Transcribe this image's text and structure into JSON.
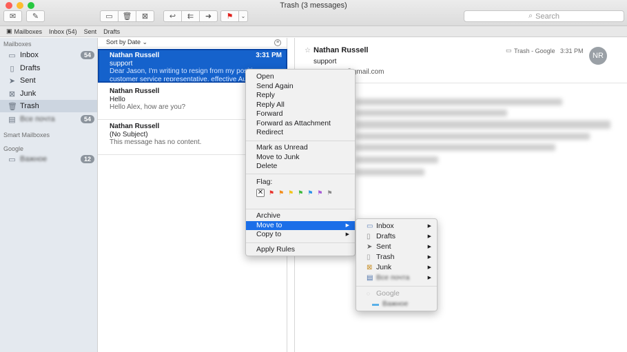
{
  "window": {
    "title": "Trash (3 messages)"
  },
  "colors": {
    "selection": "#1562cc",
    "menu_highlight": "#1b6ee8",
    "sidebar": "#e4e9ef"
  },
  "toolbar": {
    "buttons": [
      "mail-icon",
      "compose-icon",
      "archive-icon",
      "trash-icon",
      "junk-icon",
      "reply-icon",
      "reply-all-icon",
      "forward-icon",
      "flag-icon",
      "chevron-down-icon"
    ],
    "search_placeholder": "Search"
  },
  "favorites": {
    "mailboxes": "Mailboxes",
    "inbox": "Inbox (54)",
    "sent": "Sent",
    "drafts": "Drafts"
  },
  "sidebar": {
    "section_mailboxes": "Mailboxes",
    "items": [
      {
        "label": "Inbox",
        "badge": "54"
      },
      {
        "label": "Drafts"
      },
      {
        "label": "Sent"
      },
      {
        "label": "Junk"
      },
      {
        "label": "Trash"
      },
      {
        "label": "Все почта",
        "badge": "54"
      }
    ],
    "section_smart": "Smart Mailboxes",
    "section_google": "Google",
    "google_items": [
      {
        "label": "Важное",
        "badge": "12"
      }
    ]
  },
  "list": {
    "sort_label": "Sort by Date",
    "messages": [
      {
        "from": "Nathan Russell",
        "time": "3:31 PM",
        "subject": "support",
        "preview": "Dear Jason, I'm writing to resign from my position as customer service representative, effective August 15."
      },
      {
        "from": "Nathan Russell",
        "time": "",
        "subject": "Hello",
        "preview": "Hello Alex, how are you?"
      },
      {
        "from": "Nathan Russell",
        "time": "",
        "subject": "(No Subject)",
        "preview": "This message has no content."
      }
    ]
  },
  "reader": {
    "from": "Nathan Russell",
    "mailbox": "Trash - Google",
    "time": "3:31 PM",
    "subject": "support",
    "to": "To: n.......6@gmail.com",
    "avatar": "NR"
  },
  "context_menu": {
    "group1": [
      "Open",
      "Send Again",
      "Reply",
      "Reply All",
      "Forward",
      "Forward as Attachment",
      "Redirect"
    ],
    "group2": [
      "Mark as Unread",
      "Move to Junk",
      "Delete"
    ],
    "flag_label": "Flag:",
    "group3": [
      "Archive",
      "Move to",
      "Copy to"
    ],
    "group4": [
      "Apply Rules"
    ],
    "highlighted": "Move to"
  },
  "submenu": {
    "items": [
      "Inbox",
      "Drafts",
      "Sent",
      "Trash",
      "Junk",
      "Все почта"
    ],
    "google_header": "Google",
    "google_items": [
      "Важное"
    ]
  }
}
